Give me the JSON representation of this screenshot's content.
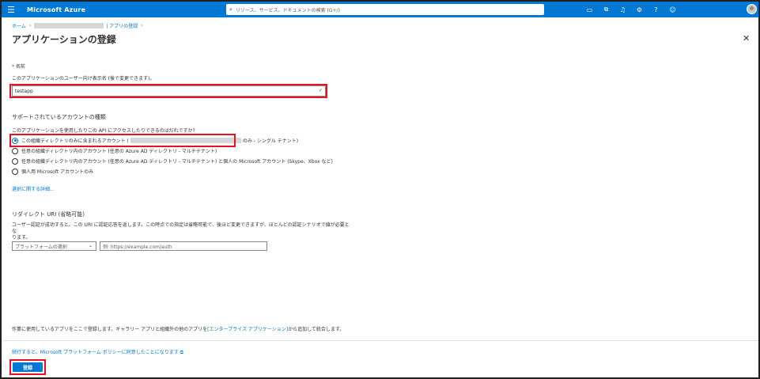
{
  "topbar": {
    "brand": "Microsoft Azure",
    "search_placeholder": "リソース、サービス、ドキュメントの検索 (G+/)"
  },
  "breadcrumb": {
    "home": "ホーム",
    "app_reg": "| アプリの登録"
  },
  "page": {
    "title": "アプリケーションの登録",
    "more": "···",
    "close": "✕"
  },
  "name_section": {
    "required_mark": "*",
    "label": "名前",
    "desc": "このアプリケーションのユーザー向け表示名 (後で変更できます)。",
    "value": "testapp",
    "valid_mark": "✓"
  },
  "account_section": {
    "title": "サポートされているアカウントの種類",
    "question": "このアプリケーションを使用したりこの API にアクセスしたりできるのはだれですか?",
    "options": [
      {
        "label_prefix": "この組織ディレクトリのみに含まれるアカウント (",
        "label_suffix": "のみ - シングル テナント)",
        "checked": true
      },
      {
        "label": "任意の組織ディレクトリ内のアカウント (任意の Azure AD ディレクトリ - マルチテナント)",
        "checked": false
      },
      {
        "label": "任意の組織ディレクトリ内のアカウント (任意の Azure AD ディレクトリ - マルチテナント) と個人の Microsoft アカウント (Skype、Xbox など)",
        "checked": false
      },
      {
        "label": "個人用 Microsoft アカウントのみ",
        "checked": false
      }
    ],
    "help_link": "選択に関する詳細..."
  },
  "redirect_section": {
    "title": "リダイレクト URI (省略可能)",
    "desc_line1": "ユーザー認証が成功すると、この URI に認証応答を返します。この時点での指定は省略可能で、後ほど変更できますが、ほとんどの認証シナリオで値が必要とな",
    "desc_line2": "ります。",
    "platform_placeholder": "プラットフォームの選択",
    "uri_placeholder": "例: https://example.com/auth"
  },
  "footer": {
    "note_prefix": "作業に使用しているアプリをここで登録します。ギャラリー アプリと組織外の他のアプリを",
    "note_link": "[エンタープライズ アプリケーション]",
    "note_suffix": "から追加して統合します。",
    "policy_link": "続行すると、Microsoft プラットフォーム ポリシーに同意したことになります",
    "register_label": "登録"
  }
}
